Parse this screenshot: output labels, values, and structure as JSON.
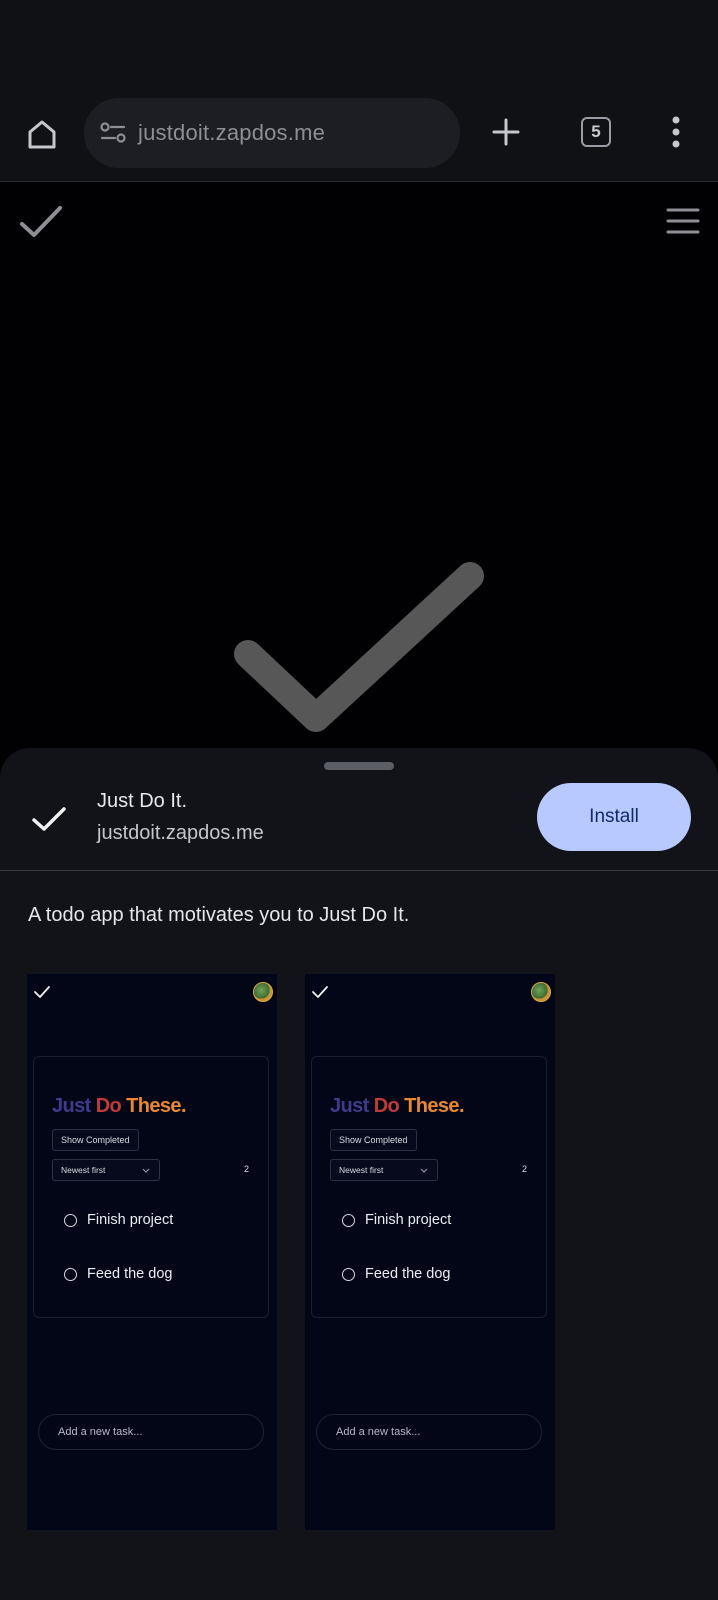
{
  "browser": {
    "url": "justdoit.zapdos.me",
    "tab_count": "5",
    "icons": {
      "home": "home-icon",
      "site_settings": "tune-icon",
      "new_tab": "plus-icon",
      "tabs": "tab-switcher-icon",
      "menu": "more-vertical-icon"
    }
  },
  "page": {
    "icons": {
      "logo": "checkmark-icon",
      "menu": "hamburger-icon",
      "splash": "checkmark-icon"
    }
  },
  "install_sheet": {
    "app_name": "Just Do It.",
    "app_url": "justdoit.zapdos.me",
    "install_label": "Install",
    "description": "A todo app that motivates you to Just Do It.",
    "screenshots": [
      {
        "title_parts": [
          "Just",
          "Do",
          "These."
        ],
        "show_completed_label": "Show Completed",
        "sort_selected": "Newest first",
        "count": "2",
        "tasks": [
          "Finish project",
          "Feed the dog"
        ],
        "input_placeholder": "Add a new task..."
      },
      {
        "title_parts": [
          "Just",
          "Do",
          "These."
        ],
        "show_completed_label": "Show Completed",
        "sort_selected": "Newest first",
        "count": "2",
        "tasks": [
          "Finish project",
          "Feed the dog"
        ],
        "input_placeholder": "Add a new task..."
      }
    ]
  },
  "colors": {
    "install_button_bg": "#b8c9ff",
    "install_button_text": "#0f2a6e",
    "title_just": "#3e3a8c",
    "title_do": "#c23a3a",
    "title_these": "#e8872e"
  }
}
